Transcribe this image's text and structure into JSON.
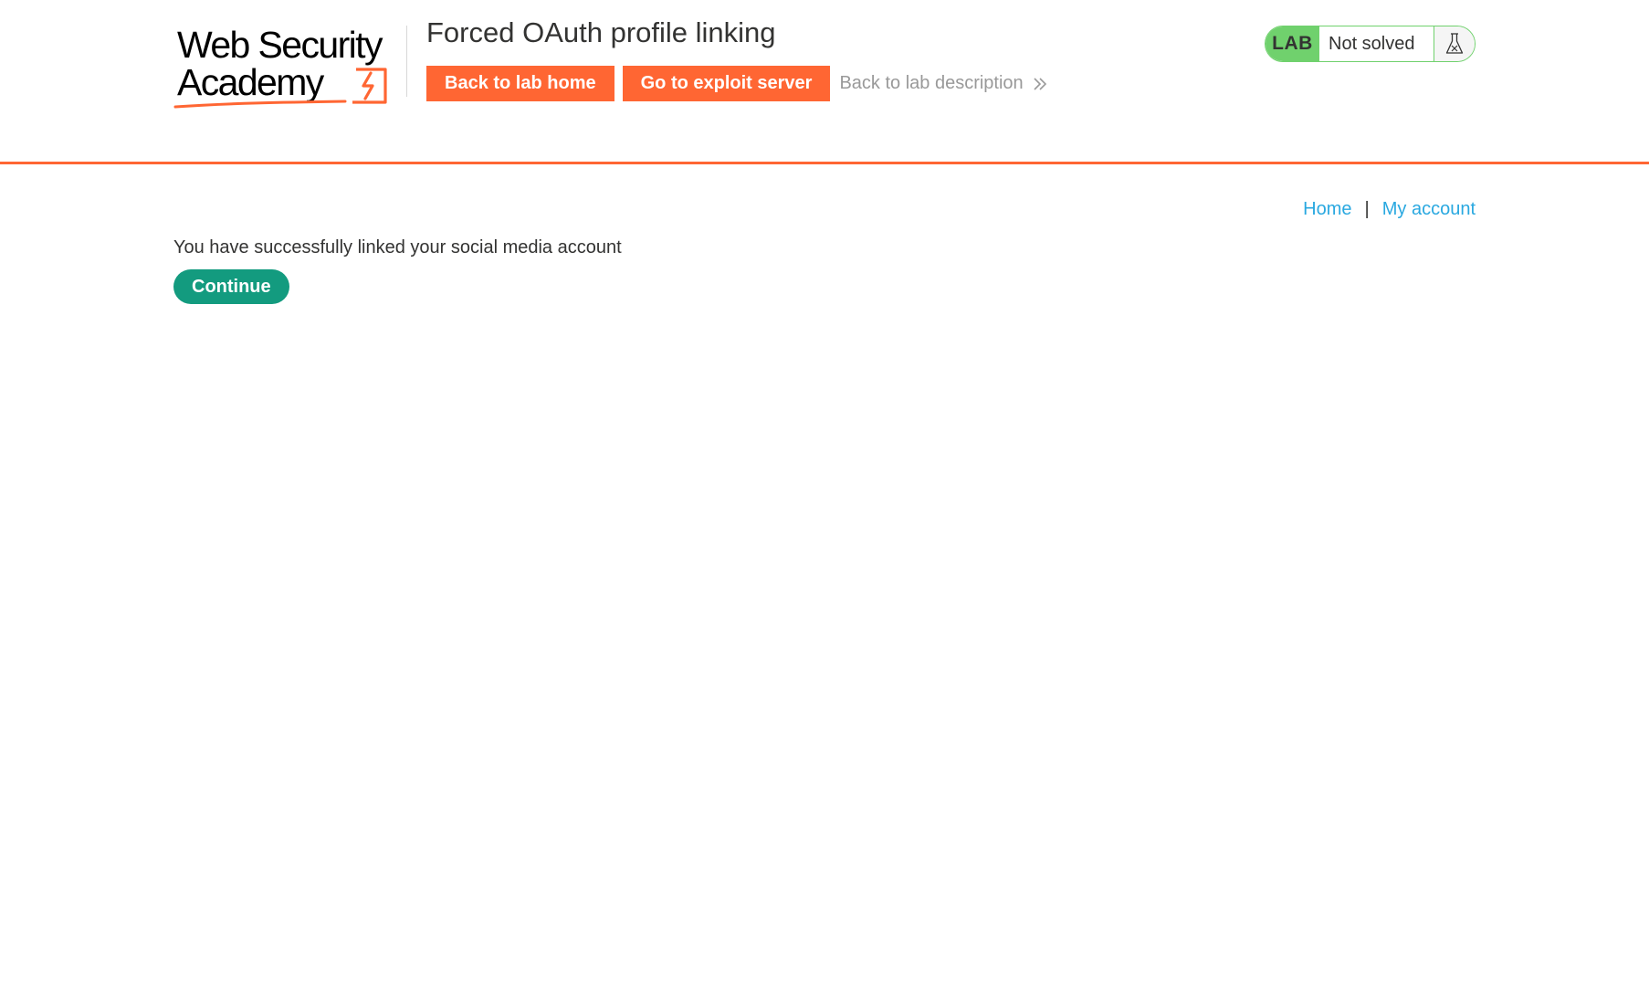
{
  "header": {
    "logo_text_line1": "Web Security",
    "logo_text_line2": "Academy",
    "title": "Forced OAuth profile linking",
    "actions": {
      "back_to_lab_home": "Back to lab home",
      "go_to_exploit_server": "Go to exploit server",
      "back_to_lab_description": "Back to lab description"
    },
    "status": {
      "label": "LAB",
      "text": "Not solved",
      "icon": "flask-icon"
    }
  },
  "nav": {
    "home": "Home",
    "separator": "|",
    "my_account": "My account"
  },
  "main": {
    "message": "You have successfully linked your social media account",
    "continue_label": "Continue"
  },
  "colors": {
    "brand_orange": "#ff6633",
    "status_green": "#70d16d",
    "link_blue": "#29a8e0",
    "continue_green": "#139b7f",
    "text": "#333332"
  }
}
